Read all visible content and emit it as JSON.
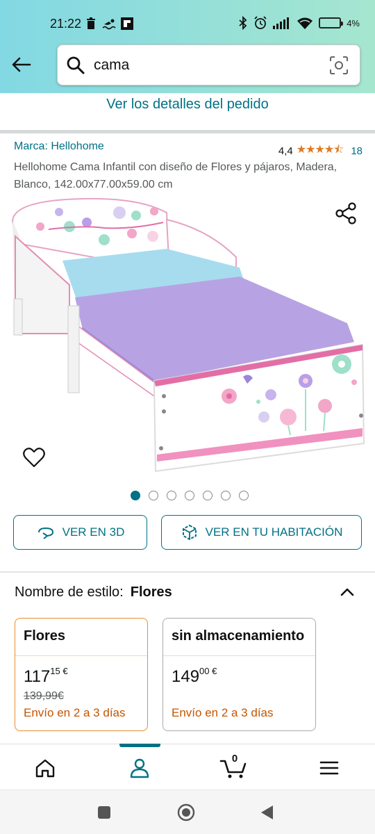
{
  "status_bar": {
    "time": "21:22",
    "battery": "4%"
  },
  "search": {
    "value": "cama"
  },
  "order_link": "Ver los detalles del pedido",
  "product": {
    "brand": "Marca: Hellohome",
    "rating_value": "4,4",
    "rating_count": "18",
    "stars": 4.5,
    "title": "Hellohome Cama Infantil con diseño de Flores y pájaros, Madera, Blanco, 142.00x77.00x59.00 cm",
    "image_count": 7,
    "active_image": 1
  },
  "actions": {
    "view_3d": "VER EN 3D",
    "view_room": "VER EN TU HABITACIÓN"
  },
  "style": {
    "label": "Nombre de estilo:",
    "selected": "Flores",
    "options": [
      {
        "name": "Flores",
        "price_whole": "117",
        "price_fraction": "15 €",
        "old_price": "139,99€",
        "shipping": "Envío en 2 a 3 días"
      },
      {
        "name": "sin almacenamiento",
        "price_whole": "149",
        "price_fraction": "00 €",
        "shipping": "Envío en 2 a 3 días"
      }
    ]
  },
  "cart": {
    "count": "0"
  },
  "colors": {
    "accent": "#007185",
    "star": "#de7921",
    "shipping": "#c45500",
    "selected_border": "#e78e2e"
  }
}
